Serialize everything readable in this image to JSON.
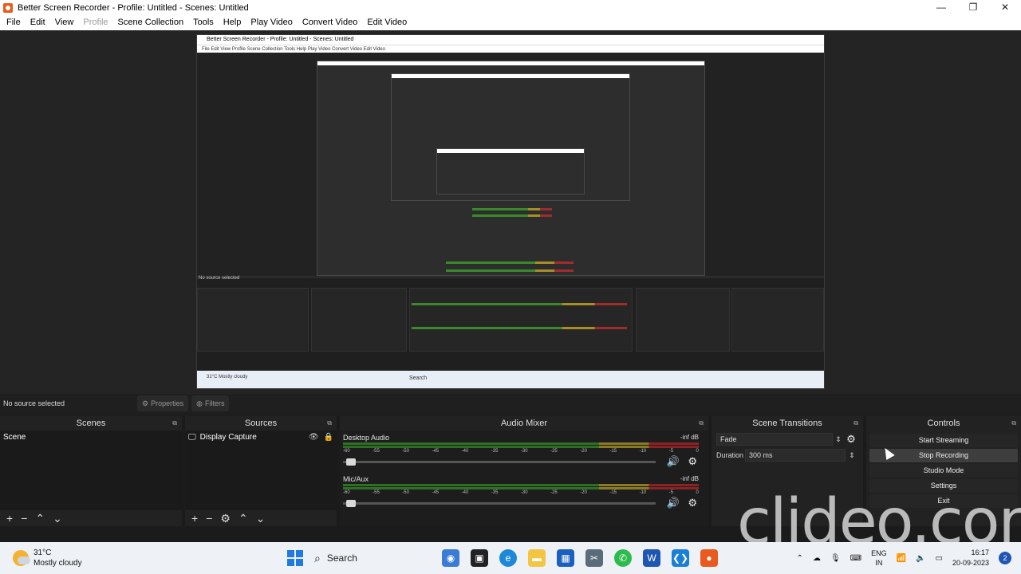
{
  "window": {
    "title": "Better Screen Recorder - Profile: Untitled - Scenes: Untitled",
    "controls": [
      "—",
      "❐",
      "✕"
    ]
  },
  "menu": [
    "File",
    "Edit",
    "View",
    "Profile",
    "Scene Collection",
    "Tools",
    "Help",
    "Play Video",
    "Convert Video",
    "Edit Video"
  ],
  "menu_disabled": "Profile",
  "toolbar": {
    "no_source": "No source selected",
    "properties": "Properties",
    "filters": "Filters"
  },
  "scenes": {
    "title": "Scenes",
    "items": [
      "Scene"
    ],
    "footer": [
      "+",
      "−",
      "⌃",
      "⌄"
    ]
  },
  "sources": {
    "title": "Sources",
    "items": [
      {
        "label": "Display Capture"
      }
    ],
    "footer": [
      "+",
      "−",
      "⚙",
      "⌃",
      "⌄"
    ]
  },
  "mixer": {
    "title": "Audio Mixer",
    "channels": [
      {
        "name": "Desktop Audio",
        "db": "-inf dB"
      },
      {
        "name": "Mic/Aux",
        "db": "-inf dB"
      }
    ],
    "ticks": [
      "-60",
      "-55",
      "-50",
      "-45",
      "-40",
      "-35",
      "-30",
      "-25",
      "-20",
      "-15",
      "-10",
      "-5",
      "0"
    ]
  },
  "transitions": {
    "title": "Scene Transitions",
    "selected": "Fade",
    "duration_label": "Duration",
    "duration_value": "300 ms"
  },
  "controls": {
    "title": "Controls",
    "buttons": [
      "Start Streaming",
      "Stop Recording",
      "Studio Mode",
      "Settings",
      "Exit"
    ]
  },
  "watermark": "clideo.com",
  "taskbar": {
    "temperature": "31°C",
    "weather": "Mostly cloudy",
    "search": "Search",
    "lang_top": "ENG",
    "lang_bottom": "IN",
    "time": "16:17",
    "date": "20-09-2023"
  },
  "nested": {
    "title": "Better Screen Recorder - Profile: Untitled - Scenes: Untitled",
    "menu": "File   Edit   View   Profile   Scene Collection   Tools   Help   Play Video   Convert Video   Edit Video",
    "no_source": "No source selected",
    "weather": "31°C Mostly cloudy",
    "search": "Search"
  }
}
